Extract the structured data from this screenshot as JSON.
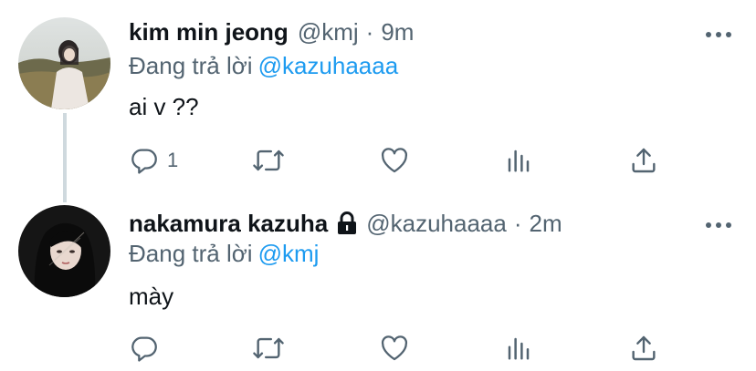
{
  "colors": {
    "link": "#1d9bf0",
    "secondary_text": "#536471",
    "primary_text": "#0f1419",
    "thread_line": "#cfd9de"
  },
  "tweets": [
    {
      "display_name": "kim min jeong",
      "handle": "@kmj",
      "separator": "·",
      "time": "9m",
      "protected": false,
      "replying_prefix": "Đang trả lời",
      "replying_to": "@kazuhaaaa",
      "text": "ai v ??",
      "reply_count": "1",
      "icons": [
        "more-icon",
        "reply-icon",
        "retweet-icon",
        "like-icon",
        "analytics-icon",
        "share-icon"
      ]
    },
    {
      "display_name": "nakamura kazuha",
      "handle": "@kazuhaaaa",
      "separator": "·",
      "time": "2m",
      "protected": true,
      "replying_prefix": "Đang trả lời",
      "replying_to": "@kmj",
      "text": "mày",
      "reply_count": "",
      "icons": [
        "lock-icon",
        "more-icon",
        "reply-icon",
        "retweet-icon",
        "like-icon",
        "analytics-icon",
        "share-icon"
      ]
    }
  ]
}
